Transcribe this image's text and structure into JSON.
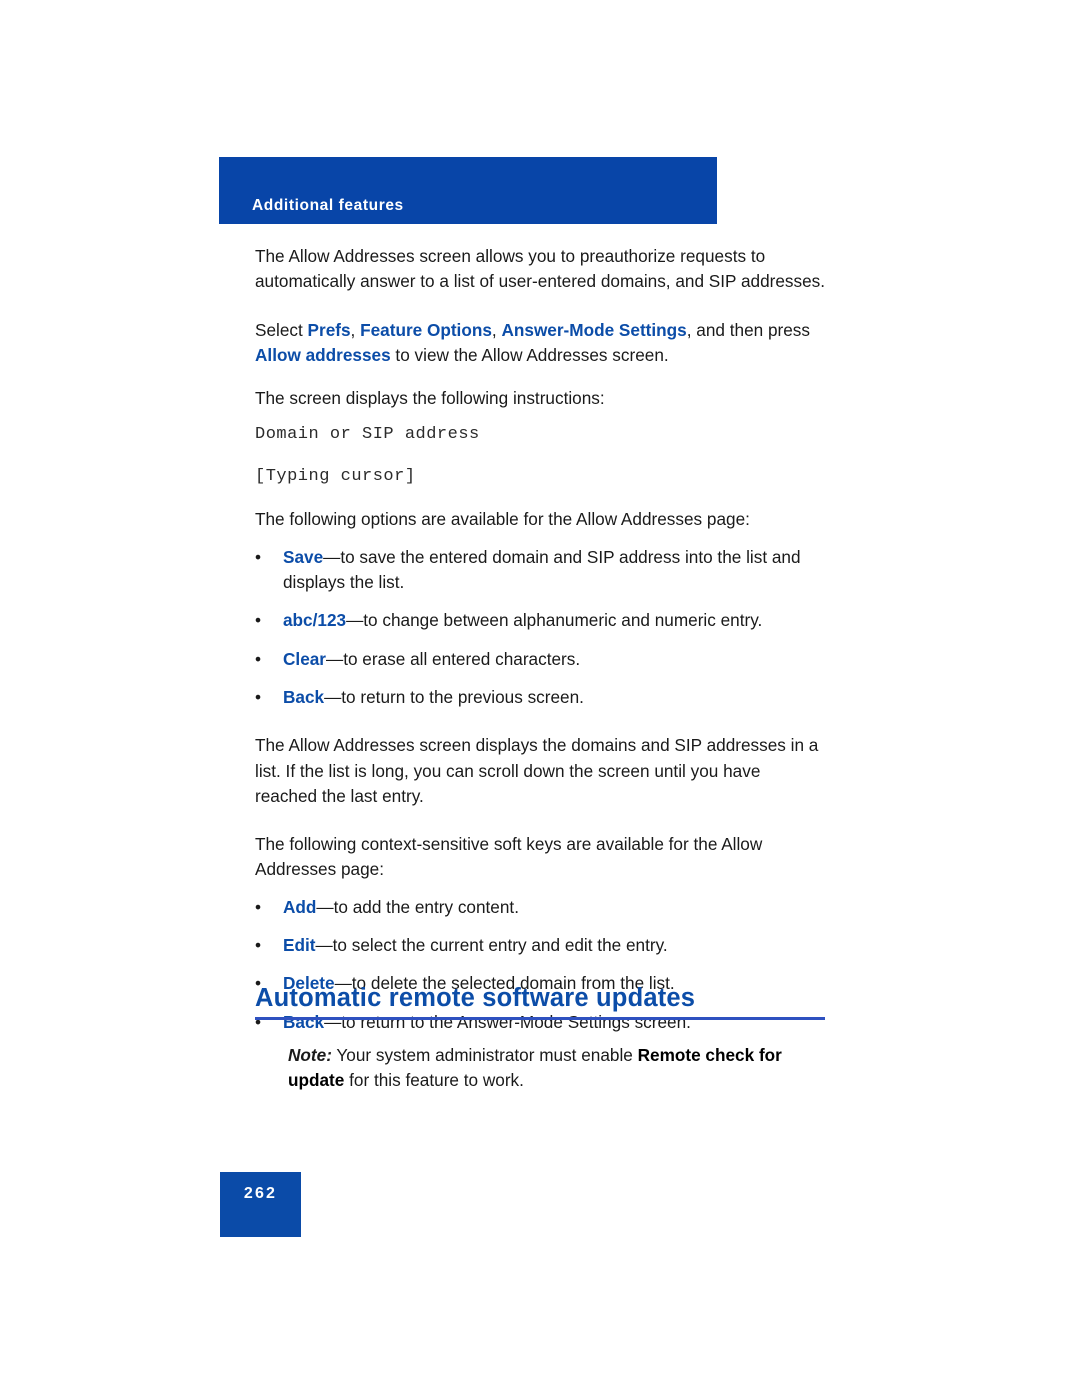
{
  "header": {
    "running_title": "Additional features"
  },
  "body": {
    "intro_paragraph": "The Allow Addresses screen allows you to preauthorize requests to automatically answer to a list of user-entered domains, and SIP addresses.",
    "navigation": {
      "prefix": "Select ",
      "step1": "Prefs",
      "sep1": ", ",
      "step2": "Feature Options",
      "sep2": ", ",
      "step3": "Answer-Mode Settings",
      "middle": ", and then press ",
      "step4": "Allow addresses",
      "suffix": " to view the Allow Addresses screen."
    },
    "instructions_lead": "The screen displays the following instructions:",
    "screen_lines": [
      "Domain or SIP address",
      "[Typing cursor]"
    ],
    "options_lead": "The following options are available for the Allow Addresses page:",
    "options": [
      {
        "term": "Save",
        "description": "—to save the entered domain and SIP address into the list and displays the list."
      },
      {
        "term": "abc/123",
        "description": "—to change between alphanumeric and numeric entry."
      },
      {
        "term": "Clear",
        "description": "—to erase all entered characters."
      },
      {
        "term": "Back",
        "description": "—to return to the previous screen."
      }
    ],
    "list_paragraph": "The Allow Addresses screen displays the domains and SIP addresses in a list. If the list is long, you can scroll down the screen until you have reached the last entry.",
    "softkeys_lead": "The following context-sensitive soft keys are available for the Allow Addresses page:",
    "softkeys": [
      {
        "term": "Add",
        "description": "—to add the entry content."
      },
      {
        "term": "Edit",
        "description": "—to select the current entry and edit the entry."
      },
      {
        "term": "Delete",
        "description": "—to delete the selected domain from the list."
      },
      {
        "term": "Back",
        "description": "—to return to the Answer-Mode Settings screen."
      }
    ]
  },
  "section": {
    "heading": "Automatic remote software updates",
    "note": {
      "label": "Note:",
      "text_before": " Your system administrator must enable ",
      "emphasis": "Remote check for update",
      "text_after": " for this feature to work."
    }
  },
  "footer": {
    "page_number": "262"
  },
  "bullet_glyph": "•",
  "colors": {
    "banner_blue": "#0845A8",
    "text_blue": "#0C4DA8",
    "rule_blue": "#2F51C0",
    "footer_blue": "#0B4BA8"
  }
}
